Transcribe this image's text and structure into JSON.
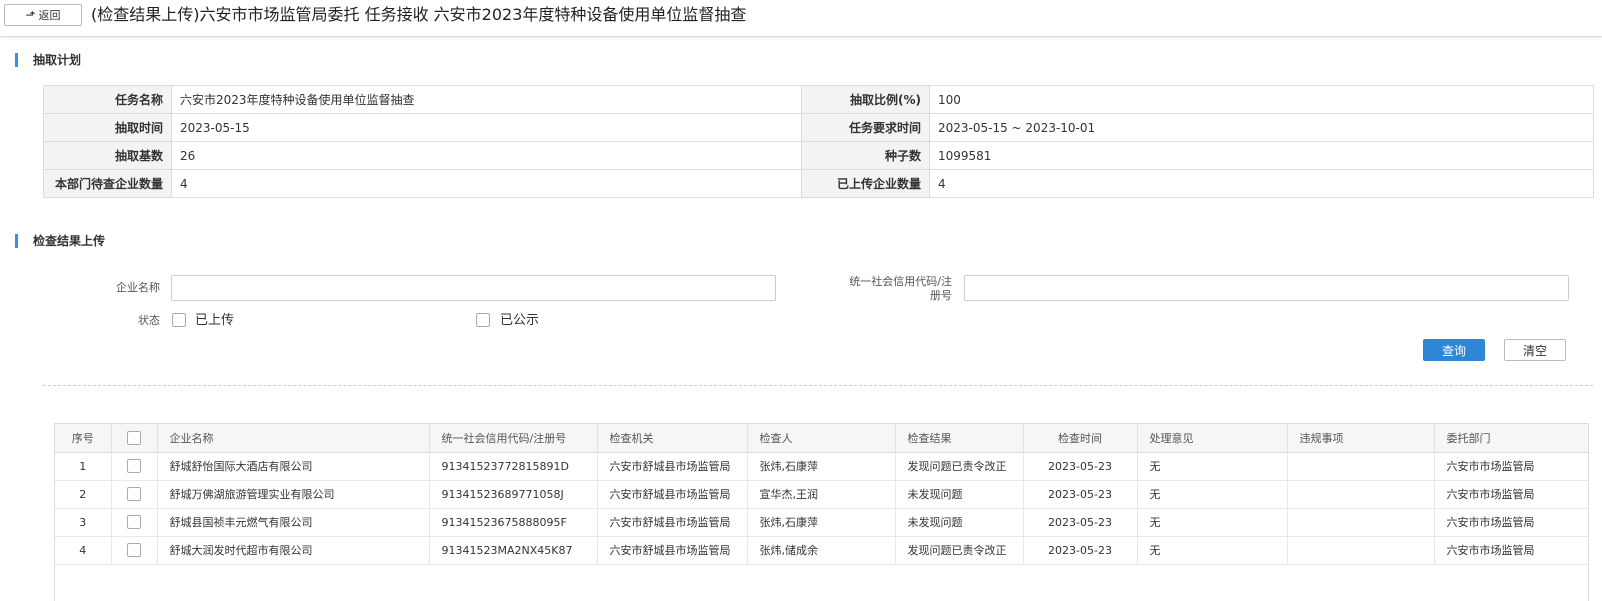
{
  "header": {
    "back_label": "返回",
    "title": "(检查结果上传)六安市市场监管局委托 任务接收 六安市2023年度特种设备使用单位监督抽查"
  },
  "plan": {
    "section_title": "抽取计划",
    "rows": [
      [
        {
          "label": "任务名称",
          "value": "六安市2023年度特种设备使用单位监督抽查"
        },
        {
          "label": "抽取比例(%)",
          "value": "100"
        }
      ],
      [
        {
          "label": "抽取时间",
          "value": "2023-05-15"
        },
        {
          "label": "任务要求时间",
          "value": "2023-05-15 ~ 2023-10-01"
        }
      ],
      [
        {
          "label": "抽取基数",
          "value": "26"
        },
        {
          "label": "种子数",
          "value": "1099581"
        }
      ],
      [
        {
          "label": "本部门待查企业数量",
          "value": "4"
        },
        {
          "label": "已上传企业数量",
          "value": "4"
        }
      ]
    ]
  },
  "upload": {
    "section_title": "检查结果上传",
    "company_label": "企业名称",
    "company_value": "",
    "credit_label": "统一社会信用代码/注册号",
    "credit_value": "",
    "status_label": "状态",
    "status_uploaded": "已上传",
    "status_published": "已公示",
    "query_button": "查询",
    "clear_button": "清空"
  },
  "results": {
    "columns": [
      "序号",
      "",
      "企业名称",
      "统一社会信用代码/注册号",
      "检查机关",
      "检查人",
      "检查结果",
      "检查时间",
      "处理意见",
      "违规事项",
      "委托部门"
    ],
    "rows": [
      [
        "1",
        "",
        "舒城舒怡国际大酒店有限公司",
        "91341523772815891D",
        "六安市舒城县市场监管局",
        "张炜,石康萍",
        "发现问题已责令改正",
        "2023-05-23",
        "无",
        "",
        "六安市市场监管局"
      ],
      [
        "2",
        "",
        "舒城万佛湖旅游管理实业有限公司",
        "9134152368977105​8J",
        "六安市舒城县市场监管局",
        "宣华杰,王润",
        "未发现问题",
        "2023-05-23",
        "无",
        "",
        "六安市市场监管局"
      ],
      [
        "3",
        "",
        "舒城县国祯丰元燃气有限公司",
        "91341523675888095F",
        "六安市舒城县市场监管局",
        "张炜,石康萍",
        "未发现问题",
        "2023-05-23",
        "无",
        "",
        "六安市市场监管局"
      ],
      [
        "4",
        "",
        "舒城大润发时代超市有限公司",
        "91341523MA2NX45K87",
        "六安市舒城县市场监管局",
        "张炜,储成余",
        "发现问题已责令改正",
        "2023-05-23",
        "无",
        "",
        "六安市市场监管局"
      ]
    ]
  },
  "colors": {
    "accent": "#2f86d6",
    "section_bar": "#3a8ee6",
    "label_bg": "#f2f3f5"
  }
}
